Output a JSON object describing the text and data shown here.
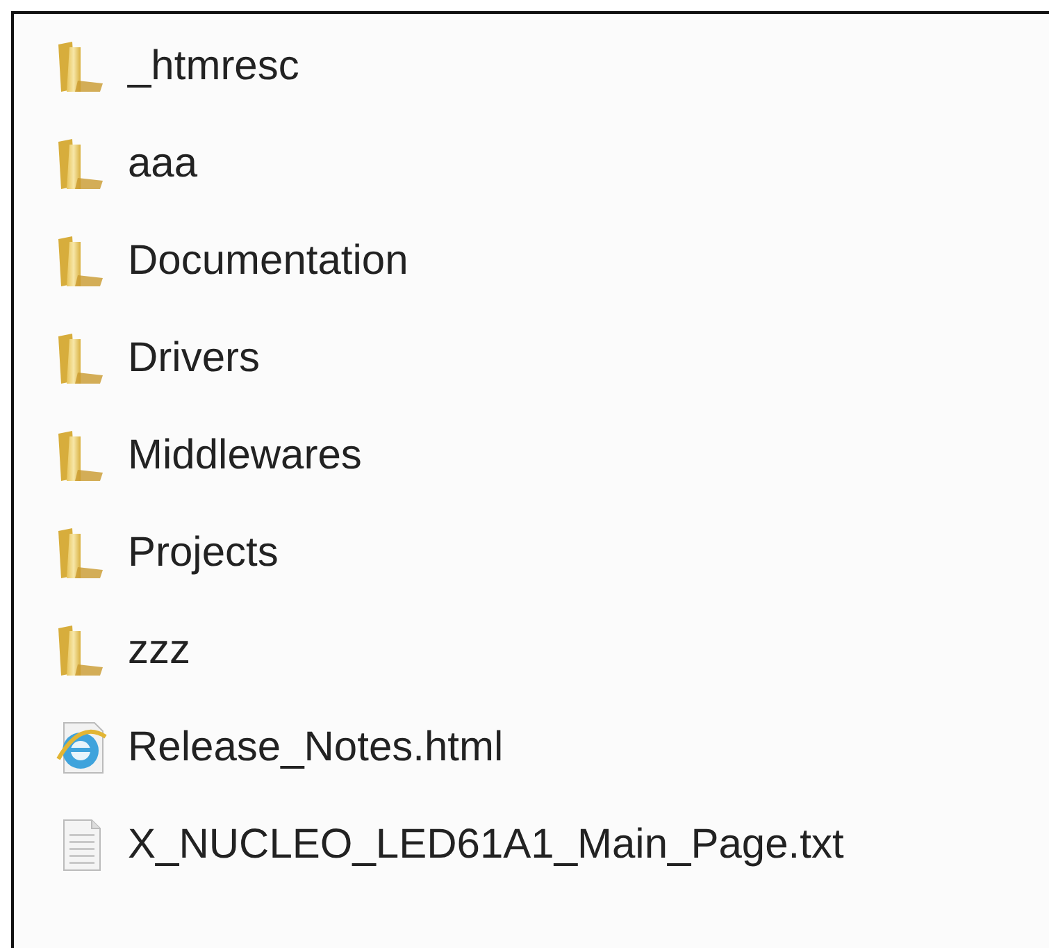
{
  "files": [
    {
      "name": "_htmresc",
      "kind": "folder"
    },
    {
      "name": "aaa",
      "kind": "folder"
    },
    {
      "name": "Documentation",
      "kind": "folder"
    },
    {
      "name": "Drivers",
      "kind": "folder"
    },
    {
      "name": "Middlewares",
      "kind": "folder"
    },
    {
      "name": "Projects",
      "kind": "folder"
    },
    {
      "name": "zzz",
      "kind": "folder"
    },
    {
      "name": "Release_Notes.html",
      "kind": "web"
    },
    {
      "name": "X_NUCLEO_LED61A1_Main_Page.txt",
      "kind": "text"
    }
  ]
}
